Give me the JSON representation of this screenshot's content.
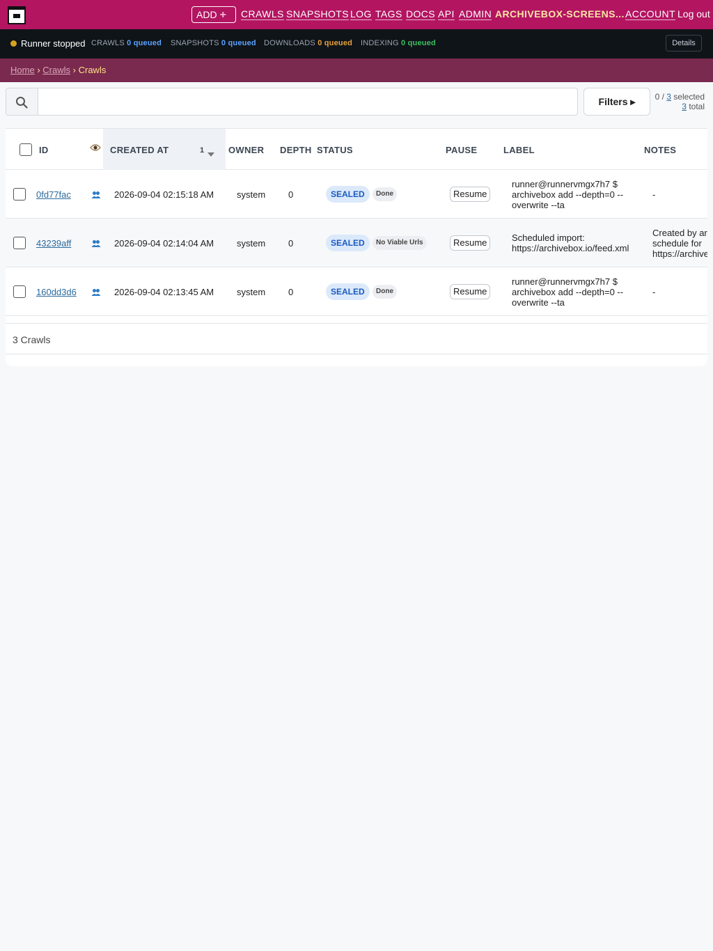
{
  "topnav": {
    "add_label": "ADD",
    "links": [
      "CRAWLS",
      "SNAPSHOTS",
      "LOG",
      "TAGS",
      "DOCS",
      "API",
      "ADMIN"
    ],
    "user": "ARCHIVEBOX-SCREENS...",
    "account": "ACCOUNT",
    "logout": "Log out"
  },
  "status": {
    "runner": "Runner stopped",
    "crawls_label": "CRAWLS",
    "crawls_value": "0 queued",
    "snapshots_label": "SNAPSHOTS",
    "snapshots_value": "0 queued",
    "downloads_label": "DOWNLOADS",
    "downloads_value": "0 queued",
    "indexing_label": "INDEXING",
    "indexing_value": "0 queued",
    "details": "Details",
    "colors": {
      "crawls": "#5aa2ff",
      "snapshots": "#5aa2ff",
      "downloads": "#e6a23c",
      "indexing": "#3fbf5f",
      "runner_dot": "#d7a21c"
    }
  },
  "breadcrumb": {
    "home": "Home",
    "sep": "›",
    "crawls": "Crawls",
    "current": "Crawls"
  },
  "search": {
    "value": "",
    "filters": "Filters ▸",
    "selected_prefix": "0 / ",
    "selected_total": "3",
    "selected_suffix": " selected",
    "total_count": "3",
    "total_suffix": " total"
  },
  "table": {
    "headers": {
      "id": "ID",
      "view_icon": "eye-icon",
      "created_at": "CREATED AT",
      "sort_index": "1",
      "owner": "OWNER",
      "depth": "DEPTH",
      "status": "STATUS",
      "pause": "PAUSE",
      "label": "LABEL",
      "notes": "NOTES"
    },
    "rows": [
      {
        "id": "0fd77fac",
        "created_at": "2026-09-04 02:15:18 AM",
        "owner": "system",
        "depth": "0",
        "status": "SEALED",
        "substatus": "Done",
        "pause": "Resume",
        "label": "runner@runnervmgx7h7 $ archivebox add --depth=0 --overwrite --ta",
        "notes": "-"
      },
      {
        "id": "43239aff",
        "created_at": "2026-09-04 02:14:04 AM",
        "owner": "system",
        "depth": "0",
        "status": "SEALED",
        "substatus": "No Viable Urls",
        "pause": "Resume",
        "label": "Scheduled import: https://archivebox.io/feed.xml",
        "notes": "Created by ar schedule for https://archive"
      },
      {
        "id": "160dd3d6",
        "created_at": "2026-09-04 02:13:45 AM",
        "owner": "system",
        "depth": "0",
        "status": "SEALED",
        "substatus": "Done",
        "pause": "Resume",
        "label": "runner@runnervmgx7h7 $ archivebox add --depth=0 --overwrite --ta",
        "notes": "-"
      }
    ],
    "footer": "3 Crawls"
  }
}
